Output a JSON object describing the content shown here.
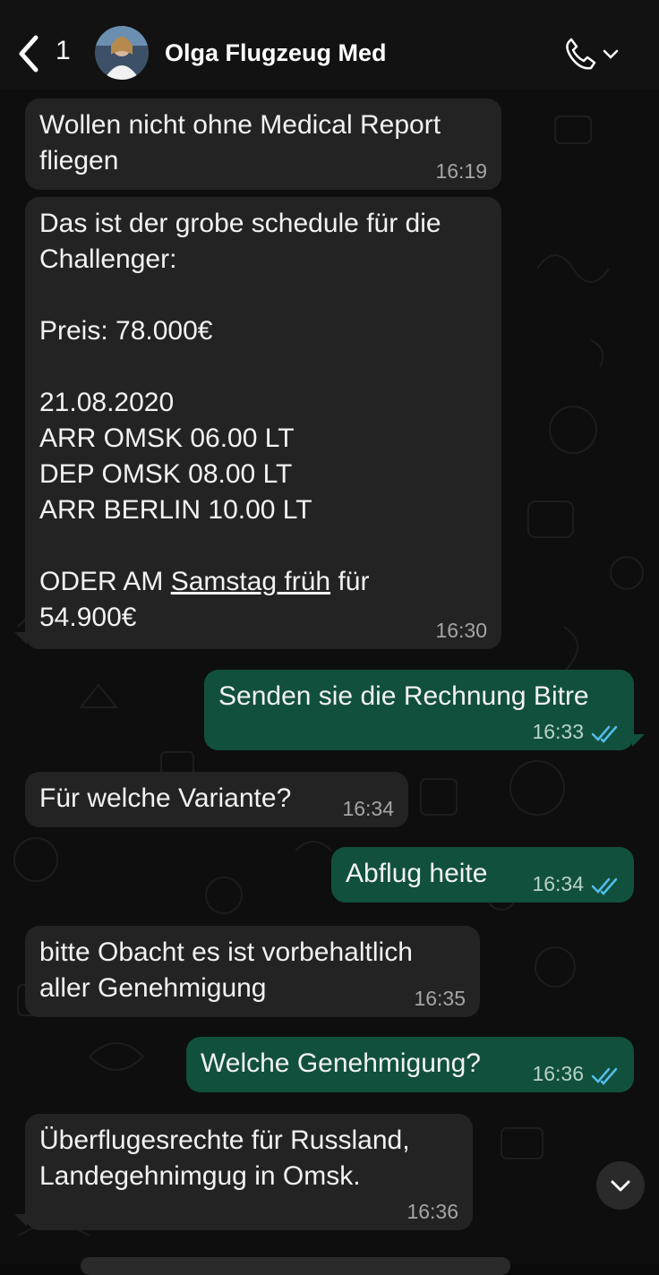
{
  "header": {
    "back_count": "1",
    "contact_name": "Olga Flugzeug Med"
  },
  "messages": [
    {
      "text": "Wollen nicht ohne Medical Report\nfliegen",
      "time": "16:19"
    },
    {
      "text_a": "Das ist der grobe schedule für die\nChallenger:\n\nPreis: 78.000€\n\n21.08.2020\nARR OMSK 06.00 LT\nDEP OMSK 08.00 LT\nARR BERLIN 10.00 LT\n\nODER AM ",
      "link": "Samstag früh",
      "text_b": " für\n54.900€",
      "time": "16:30"
    },
    {
      "text": "Senden sie die Rechnung Bitre",
      "time": "16:33"
    },
    {
      "text": "Für welche Variante?",
      "time": "16:34"
    },
    {
      "text": "Abflug heite",
      "time": "16:34"
    },
    {
      "text": "bitte Obacht es ist vorbehaltlich\naller Genehmigung",
      "time": "16:35"
    },
    {
      "text": "Welche Genehmigung?",
      "time": "16:36"
    },
    {
      "text": "Überflugesrechte für Russland,\nLandegehnimgug in Omsk.",
      "time": "16:36"
    }
  ],
  "colors": {
    "incoming_bubble": "#232323",
    "outgoing_bubble": "#11503d",
    "read_ticks": "#53bdeb"
  },
  "icons": [
    "back-chevron-icon",
    "phone-icon",
    "chevron-down-icon",
    "double-check-icon",
    "scroll-down-icon"
  ]
}
